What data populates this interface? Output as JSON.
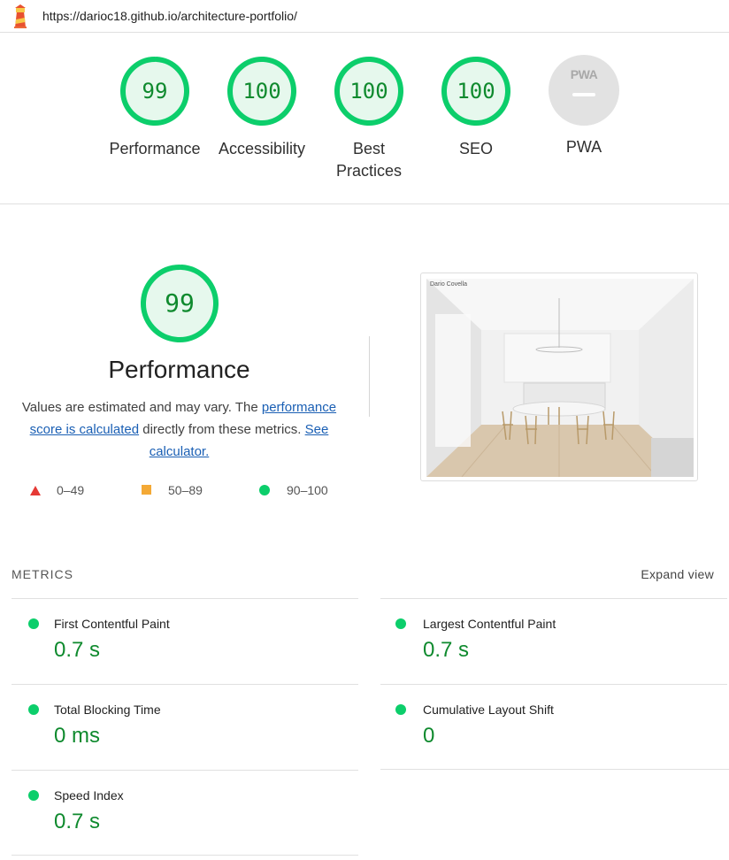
{
  "topbar": {
    "url": "https://darioc18.github.io/architecture-portfolio/"
  },
  "gauges": [
    {
      "score": "99",
      "label": "Performance",
      "fraction": 0.99
    },
    {
      "score": "100",
      "label": "Accessibility",
      "fraction": 1.0
    },
    {
      "score": "100",
      "label": "Best Practices",
      "fraction": 1.0
    },
    {
      "score": "100",
      "label": "SEO",
      "fraction": 1.0
    },
    {
      "score": "PWA",
      "label": "PWA",
      "fraction": null
    }
  ],
  "performance": {
    "score": "99",
    "fraction": 0.99,
    "title": "Performance",
    "desc_prefix": "Values are estimated and may vary. The ",
    "desc_link1": "performance score is calculated",
    "desc_middle": " directly from these metrics. ",
    "desc_link2": "See calculator."
  },
  "legend": [
    {
      "range": "0–49",
      "color": "#e53935",
      "shape": "triangle"
    },
    {
      "range": "50–89",
      "color": "#f4a935",
      "shape": "square"
    },
    {
      "range": "90–100",
      "color": "#0cce6b",
      "shape": "circle"
    }
  ],
  "screenshot": {
    "caption": "Dario Covella"
  },
  "metrics": {
    "heading": "METRICS",
    "expand_label": "Expand view",
    "items": [
      {
        "title": "First Contentful Paint",
        "value": "0.7 s"
      },
      {
        "title": "Largest Contentful Paint",
        "value": "0.7 s"
      },
      {
        "title": "Total Blocking Time",
        "value": "0 ms"
      },
      {
        "title": "Cumulative Layout Shift",
        "value": "0"
      },
      {
        "title": "Speed Index",
        "value": "0.7 s"
      }
    ]
  },
  "colors": {
    "pass_green": "#0cce6b",
    "score_text": "#0f8a2e",
    "link_blue": "#1a5fb4"
  }
}
